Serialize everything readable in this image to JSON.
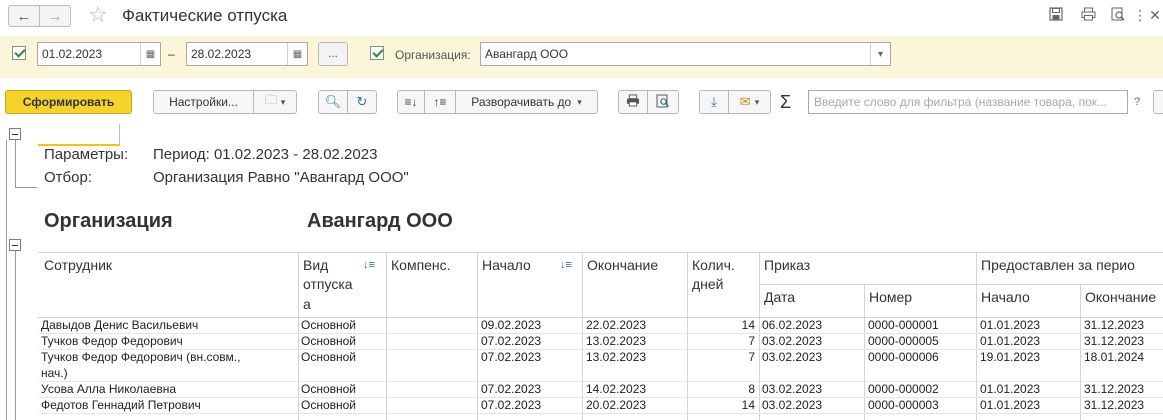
{
  "window": {
    "title": "Фактические отпуска"
  },
  "filter": {
    "date_from": "01.02.2023",
    "separator": "–",
    "date_to": "28.02.2023",
    "more_label": "...",
    "org_label": "Организация:",
    "org_value": "Авангард ООО"
  },
  "toolbar": {
    "generate_label": "Сформировать",
    "settings_label": "Настройки...",
    "expand_label": "Разворачивать до",
    "sigma": "Σ",
    "search_placeholder": "Введите слово для фильтра (название товара, пок...",
    "help": "?"
  },
  "report": {
    "params_label": "Параметры:",
    "params_value": "Период: 01.02.2023 - 28.02.2023",
    "filter_label": "Отбор:",
    "filter_value": "Организация Равно \"Авангард ООО\"",
    "org_heading_label": "Организация",
    "org_heading_value": "Авангард ООО",
    "columns": {
      "employee": "Сотрудник",
      "type_line1": "Вид",
      "type_line2": "отпуска",
      "type_line3": "а",
      "comp": "Компенс.",
      "start": "Начало",
      "end": "Окончание",
      "days_line1": "Колич.",
      "days_line2": "дней",
      "order": "Приказ",
      "order_date": "Дата",
      "order_num": "Номер",
      "granted": "Предоставлен за перио",
      "granted_start": "Начало",
      "granted_end": "Окончание"
    },
    "rows": [
      {
        "employee": "Давыдов Денис Васильевич",
        "employee2": "",
        "type": "Основной",
        "start": "09.02.2023",
        "end": "22.02.2023",
        "days": "14",
        "order_date": "06.02.2023",
        "order_num": "0000-000001",
        "g_start": "01.01.2023",
        "g_end": "31.12.2023"
      },
      {
        "employee": "Тучков Федор Федорович",
        "employee2": "",
        "type": "Основной",
        "start": "07.02.2023",
        "end": "13.02.2023",
        "days": "7",
        "order_date": "03.02.2023",
        "order_num": "0000-000005",
        "g_start": "01.01.2023",
        "g_end": "31.12.2023"
      },
      {
        "employee": "Тучков Федор Федорович (вн.совм.,",
        "employee2": "нач.)",
        "type": "Основной",
        "start": "07.02.2023",
        "end": "13.02.2023",
        "days": "7",
        "order_date": "03.02.2023",
        "order_num": "0000-000006",
        "g_start": "19.01.2023",
        "g_end": "18.01.2024"
      },
      {
        "employee": "Усова Алла Николаевна",
        "employee2": "",
        "type": "Основной",
        "start": "07.02.2023",
        "end": "14.02.2023",
        "days": "8",
        "order_date": "03.02.2023",
        "order_num": "0000-000002",
        "g_start": "01.01.2023",
        "g_end": "31.12.2023"
      },
      {
        "employee": "Федотов Геннадий Петрович",
        "employee2": "",
        "type": "Основной",
        "start": "07.02.2023",
        "end": "20.02.2023",
        "days": "14",
        "order_date": "03.02.2023",
        "order_num": "0000-000003",
        "g_start": "01.01.2023",
        "g_end": "31.12.2023"
      }
    ]
  },
  "icons": {
    "back": "arrow-left-icon",
    "forward": "arrow-right-icon",
    "favorite": "star-icon",
    "save": "save-icon",
    "print": "print-icon",
    "search": "search-icon",
    "more": "more-vert-icon",
    "close": "close-icon"
  }
}
